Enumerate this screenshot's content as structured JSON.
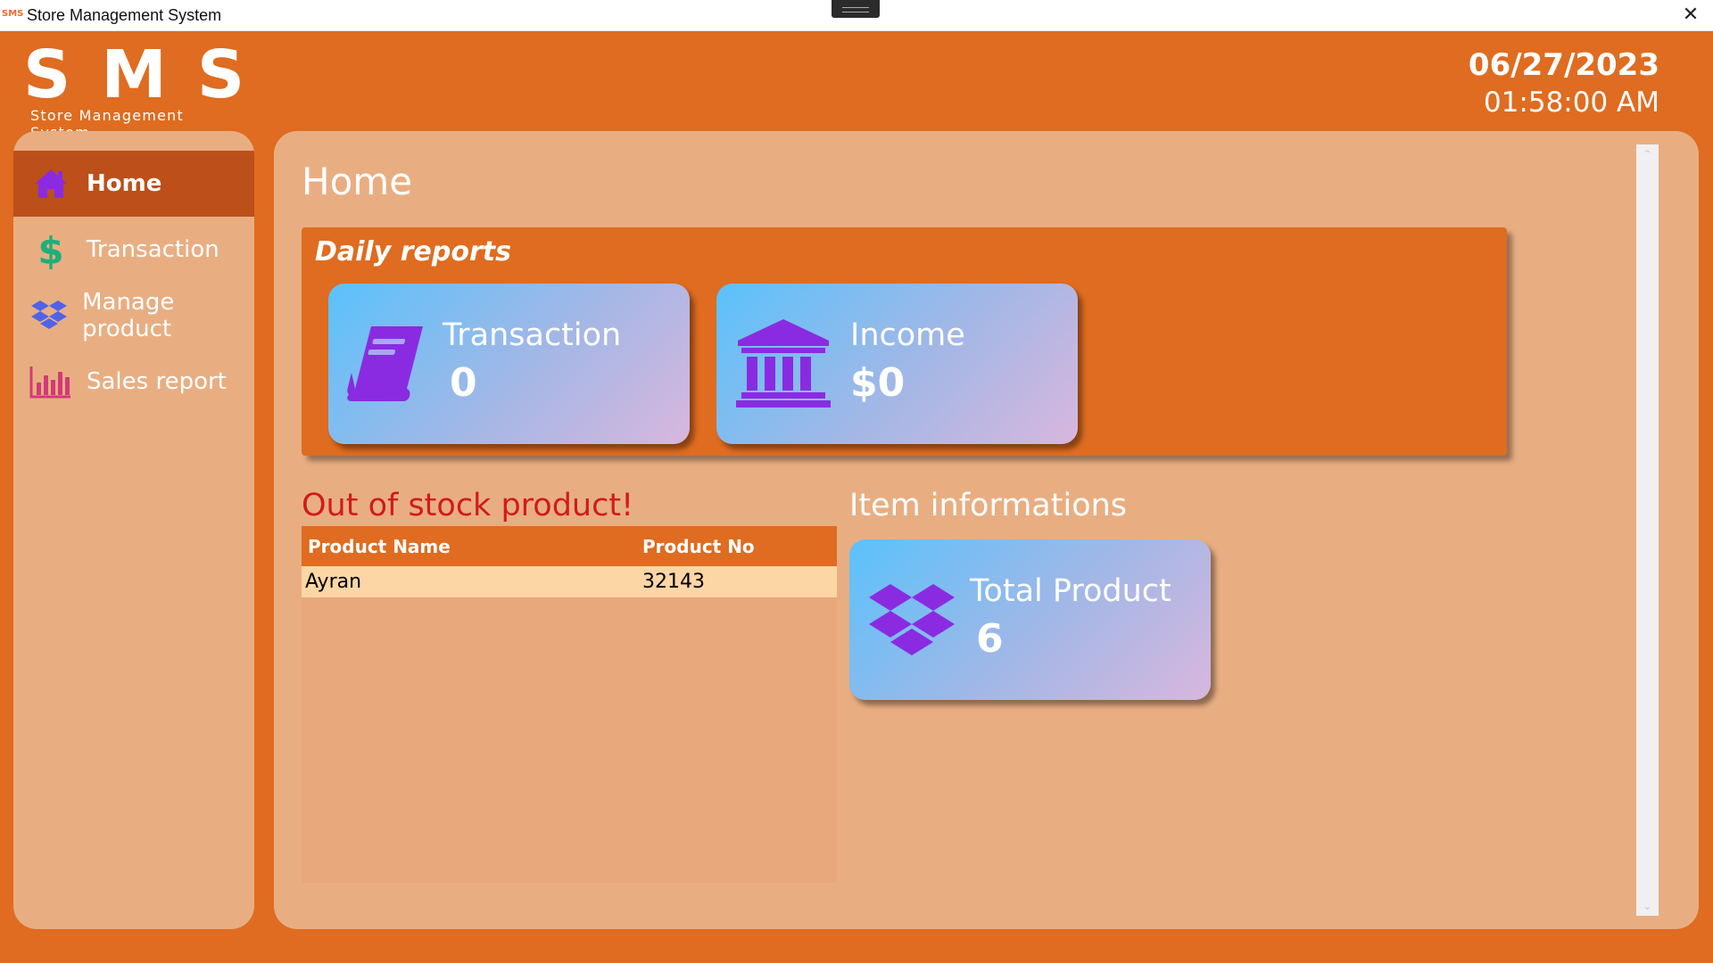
{
  "window": {
    "app_icon_text": "SMS",
    "title": "Store Management System",
    "close_glyph": "✕"
  },
  "logo": {
    "letters": "SMS",
    "subtitle": "Store Management System"
  },
  "header": {
    "date": "06/27/2023",
    "time": "01:58:00 AM"
  },
  "sidebar": {
    "items": [
      {
        "label": "Home",
        "icon": "home-icon",
        "active": true
      },
      {
        "label": "Transaction",
        "icon": "dollar-icon",
        "active": false
      },
      {
        "label": "Manage product",
        "icon": "dropbox-icon",
        "active": false
      },
      {
        "label": "Sales report",
        "icon": "bar-chart-icon",
        "active": false
      }
    ]
  },
  "main": {
    "page_title": "Home",
    "daily_reports": {
      "header": "Daily reports",
      "cards": [
        {
          "title": "Transaction",
          "value": "0",
          "icon": "book-icon"
        },
        {
          "title": "Income",
          "value": "$0",
          "icon": "bank-icon"
        }
      ]
    },
    "out_of_stock": {
      "title": "Out of stock product!",
      "columns": [
        "Product Name",
        "Product No"
      ],
      "rows": [
        [
          "Ayran",
          "32143"
        ]
      ]
    },
    "item_info": {
      "title": "Item informations",
      "card": {
        "title": "Total Product",
        "value": "6",
        "icon": "dropbox-icon"
      }
    }
  },
  "colors": {
    "background": "#df6c20",
    "panel": "#e8ae82",
    "active_nav": "#bd4f1a",
    "alert_text": "#d21b1b",
    "icon_purple": "#8a2be2"
  }
}
